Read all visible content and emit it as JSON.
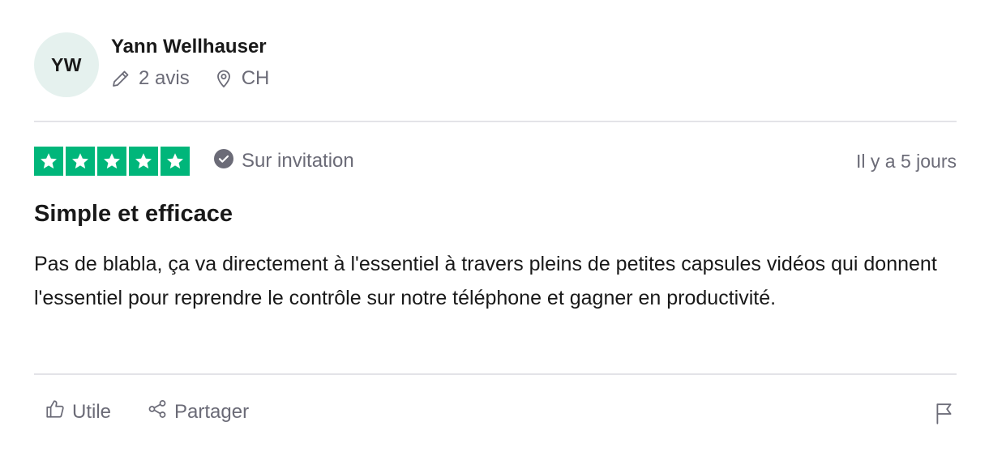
{
  "reviewer": {
    "initials": "YW",
    "name": "Yann Wellhauser",
    "review_count": "2 avis",
    "country": "CH",
    "avatar_color": "#e5f1ee"
  },
  "review": {
    "rating": 5,
    "rating_max": 5,
    "star_color": "#00b67a",
    "verified_label": "Sur invitation",
    "date": "Il y a 5 jours",
    "title": "Simple et efficace",
    "body": "Pas de blabla, ça va directement à l'essentiel à travers pleins de petites capsules vidéos qui donnent l'essentiel pour reprendre le contrôle sur notre téléphone et gagner en productivité."
  },
  "actions": {
    "useful_label": "Utile",
    "share_label": "Partager"
  },
  "icons": {
    "review_count": "pencil-icon",
    "country": "location-pin-icon",
    "verified": "check-circle-icon",
    "useful": "thumbs-up-icon",
    "share": "share-icon",
    "report": "flag-icon"
  }
}
